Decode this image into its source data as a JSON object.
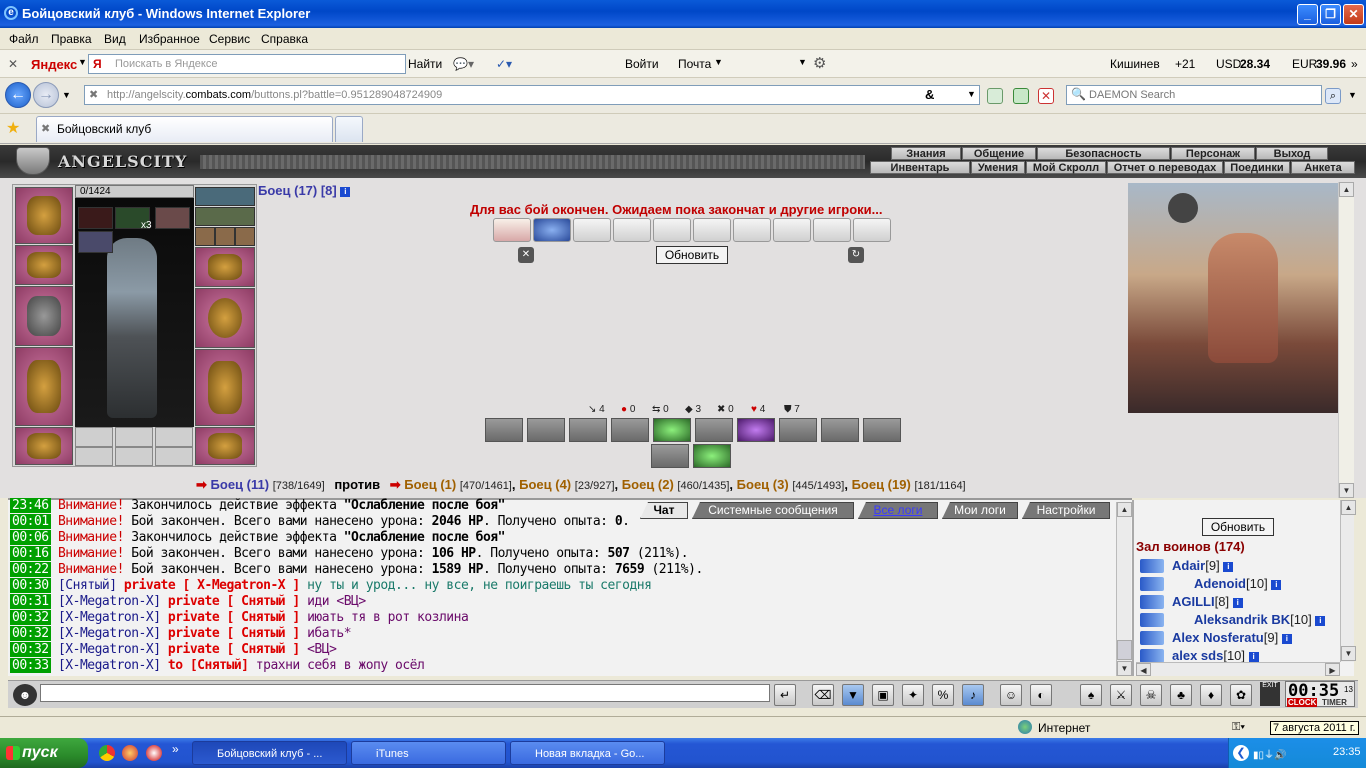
{
  "window": {
    "title": "Бойцовский клуб - Windows Internet Explorer"
  },
  "menu": [
    "Файл",
    "Правка",
    "Вид",
    "Избранное",
    "Сервис",
    "Справка"
  ],
  "yandex_bar": {
    "brand": "Яндекс",
    "search_placeholder": "Поискать в Яндексе",
    "find": "Найти",
    "login": "Войти",
    "mail": "Почта",
    "city": "Кишинев",
    "temp": "+21",
    "usd_label": "USD",
    "usd_value": "28.34",
    "eur_label": "EUR",
    "eur_value": "39.96"
  },
  "address": {
    "url_prefix": "http://angelscity.",
    "url_domain": "combats.com",
    "url_path": "/buttons.pl?battle=0.951289048724909",
    "search_placeholder": "DAEMON Search"
  },
  "tabs": [
    {
      "label": "Бойцовский клуб"
    }
  ],
  "game": {
    "logo": "ANGELSCITY",
    "menu_top": [
      "Знания",
      "Общение",
      "Безопасность",
      "Персонаж",
      "Выход"
    ],
    "menu_bottom": [
      "Инвентарь",
      "Умения",
      "Мой Скролл",
      "Отчет о переводах",
      "Поединки",
      "Анкета"
    ],
    "hp": "0/1424",
    "stack_count": "x3",
    "player_name": "Боец (17) [8]",
    "battle_message": "Для вас бой окончен. Ожидаем пока закончат и другие игроки...",
    "refresh_button": "Обновить",
    "stats": [
      "4",
      "0",
      "0",
      "3",
      "0",
      "4",
      "7"
    ],
    "fight_line": {
      "left_name": "Боец (11)",
      "left_hp": "[738/1649]",
      "vs": "против",
      "opponents": [
        {
          "name": "Боец (1)",
          "hp": "[470/1461]"
        },
        {
          "name": "Боец (4)",
          "hp": "[23/927]"
        },
        {
          "name": "Боец (2)",
          "hp": "[460/1435]"
        },
        {
          "name": "Боец (3)",
          "hp": "[445/1493]"
        },
        {
          "name": "Боец (19)",
          "hp": "[181/1164]"
        }
      ]
    }
  },
  "chat": {
    "tabs": [
      "Чат",
      "Системные сообщения",
      "Все логи",
      "Мои логи",
      "Настройки"
    ],
    "lines": [
      {
        "time": "23:46",
        "a": "Внимание!",
        "b": " Закончилось действие эффекта ",
        "c": "\"Ослабление после боя\""
      },
      {
        "time": "00:01",
        "a": "Внимание!",
        "b": " Бой закончен. Всего вами нанесено урона: ",
        "c": "2046 HP",
        "d": ". Получено опыта: ",
        "e": "0",
        "f": "."
      },
      {
        "time": "00:06",
        "a": "Внимание!",
        "b": " Закончилось действие эффекта ",
        "c": "\"Ослабление после боя\""
      },
      {
        "time": "00:16",
        "a": "Внимание!",
        "b": " Бой закончен. Всего вами нанесено урона: ",
        "c": "106 HP",
        "d": ". Получено опыта: ",
        "e": "507",
        "f": " (211%)."
      },
      {
        "time": "00:22",
        "a": "Внимание!",
        "b": " Бой закончен. Всего вами нанесено урона: ",
        "c": "1589 HP",
        "d": ". Получено опыта: ",
        "e": "7659",
        "f": " (211%)."
      },
      {
        "time": "00:30",
        "who": "[Снятый]",
        "priv": " private [ X-Megatron-X ]",
        "msg": " ну ты и урод... ну все, не поиграешь ты сегодня"
      },
      {
        "time": "00:31",
        "who": "[X-Megatron-X]",
        "priv": " private [ Снятый ]",
        "msg": " иди <ВЦ>"
      },
      {
        "time": "00:32",
        "who": "[X-Megatron-X]",
        "priv": " private [ Снятый ]",
        "msg": " июать тя в рот козлина"
      },
      {
        "time": "00:32",
        "who": "[X-Megatron-X]",
        "priv": " private [ Снятый ]",
        "msg": " ибать*"
      },
      {
        "time": "00:32",
        "who": "[X-Megatron-X]",
        "priv": " private [ Снятый ]",
        "msg": " <ВЦ>"
      },
      {
        "time": "00:33",
        "who": "[X-Megatron-X]",
        "priv": " to [Снятый]",
        "msg": " трахни себя в жопу осёл"
      }
    ]
  },
  "warriors": {
    "refresh": "Обновить",
    "title": "Зал воинов (174)",
    "list": [
      {
        "name": "Adair",
        "lv": "[9]"
      },
      {
        "name": "Adenoid",
        "lv": "[10]"
      },
      {
        "name": "AGILLI",
        "lv": "[8]"
      },
      {
        "name": "Aleksandrik BK",
        "lv": "[10]"
      },
      {
        "name": "Alex Nosferatu",
        "lv": "[9]"
      },
      {
        "name": "alex sds",
        "lv": "[10]"
      }
    ]
  },
  "clock": {
    "time": "00:35",
    "sec": "13",
    "clock_label": "CLOCK",
    "timer_label": "TIMER",
    "exit": "EXIT"
  },
  "statusbar": {
    "zone": "Интернет",
    "date": "7 августа 2011 г."
  },
  "taskbar": {
    "start": "пуск",
    "tasks": [
      "Бойцовский клуб - ...",
      "iTunes",
      "Новая вкладка - Go..."
    ],
    "time": "23:35"
  }
}
